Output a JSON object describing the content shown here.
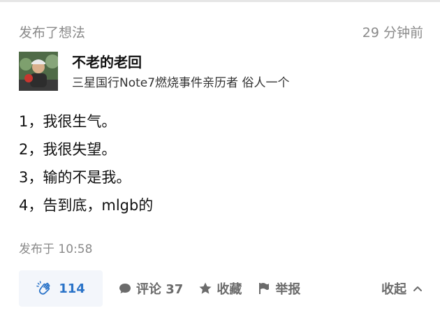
{
  "post": {
    "action_text": "发布了想法",
    "time_ago": "29 分钟前",
    "author": {
      "name": "不老的老回",
      "bio": "三星国行Note7燃烧事件亲历者 俗人一个"
    },
    "content_lines": [
      "1，我很生气。",
      "2，我很失望。",
      "3，输的不是我。",
      "4，告到底，mlgb的"
    ],
    "published_at": "发布于 10:58"
  },
  "actions": {
    "clap_count": "114",
    "comment_label": "评论 37",
    "favorite_label": "收藏",
    "report_label": "举报",
    "collapse_label": "收起"
  },
  "colors": {
    "accent": "#2a73c8",
    "muted": "#8a8a8a",
    "action_text": "#6b6b6b"
  },
  "icons": [
    "clap-icon",
    "comment-icon",
    "star-icon",
    "flag-icon",
    "chevron-up-icon"
  ]
}
